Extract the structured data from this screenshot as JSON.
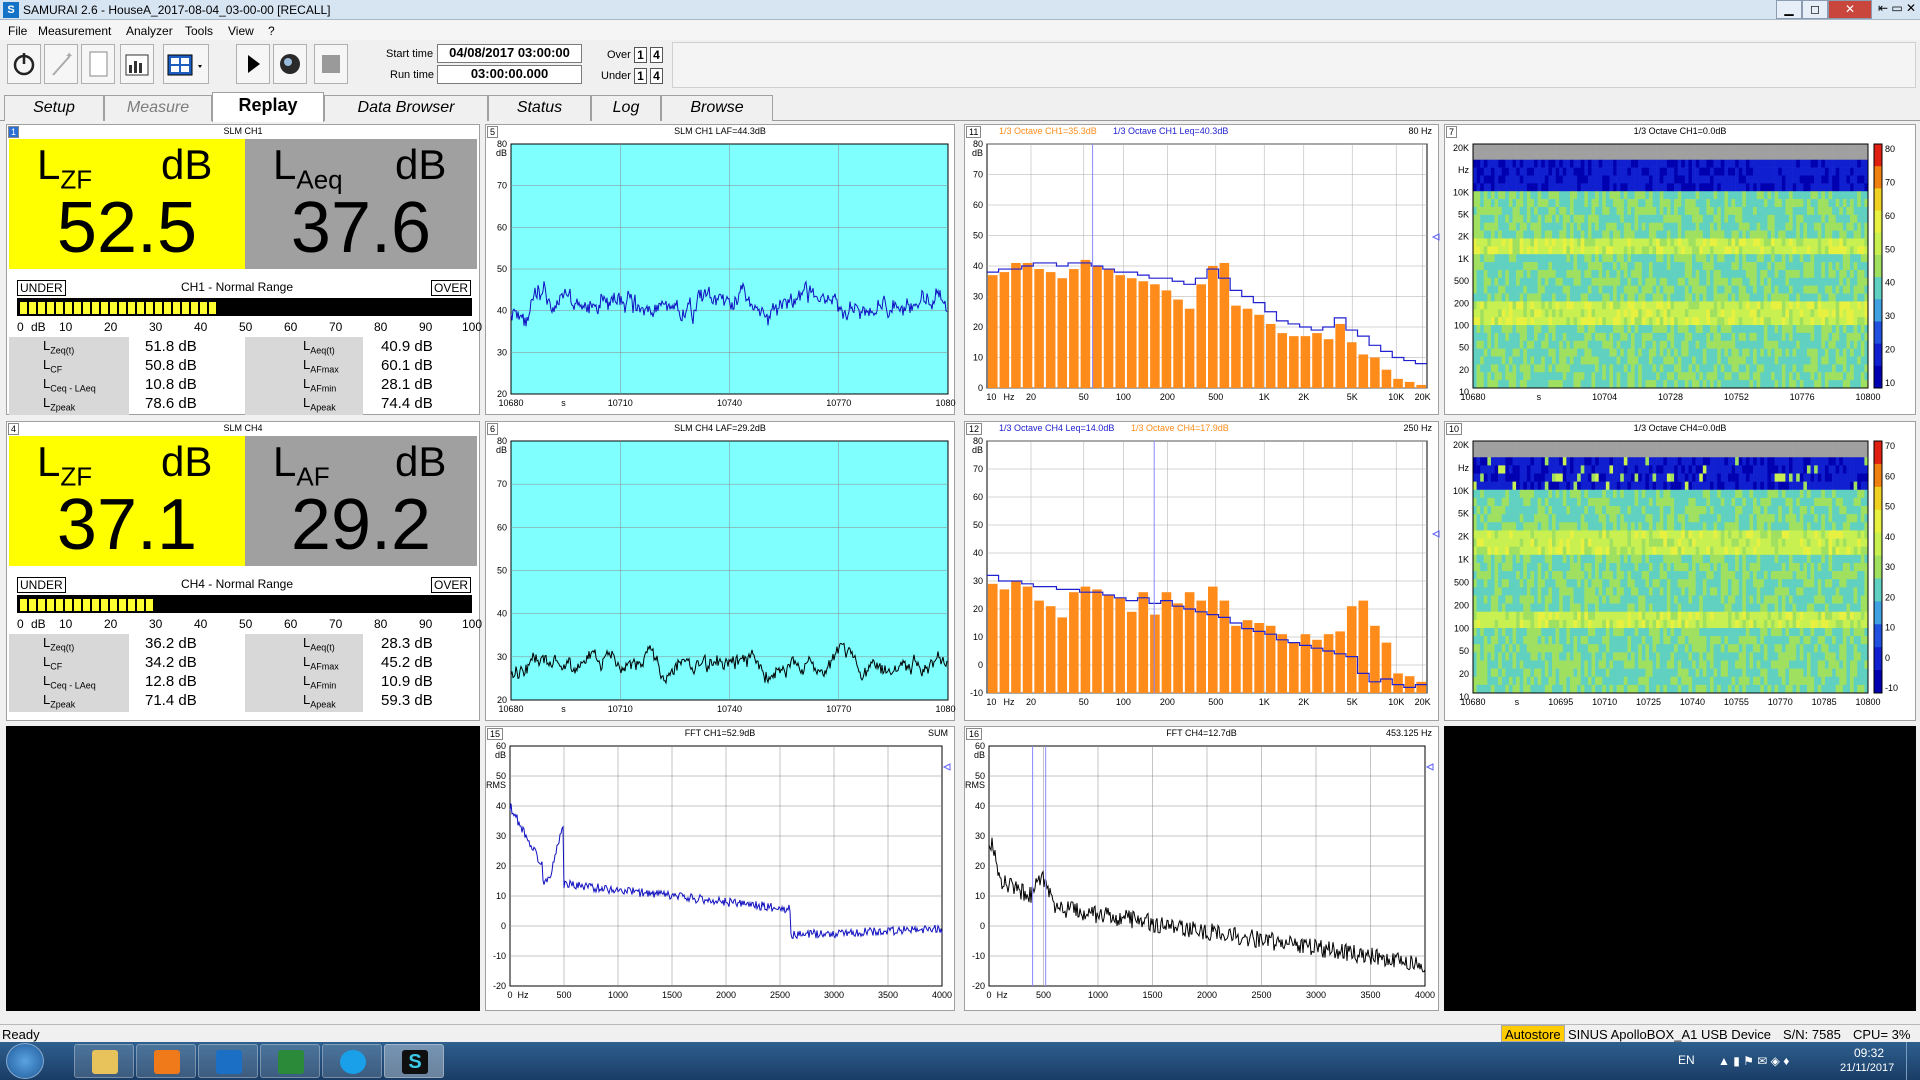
{
  "window": {
    "title": "SAMURAI 2.6 - HouseA_2017-08-04_03-00-00 [RECALL]",
    "app_icon": "S"
  },
  "menu": [
    "File",
    "Measurement",
    "Analyzer",
    "Tools",
    "View",
    "?"
  ],
  "toolbar": {
    "start_label": "Start time",
    "start_value": "04/08/2017 03:00:00",
    "run_label": "Run time",
    "run_value": "03:00:00.000",
    "over_label": "Over",
    "under_label": "Under",
    "flag1": "1",
    "flag4": "4"
  },
  "tabs": [
    "Setup",
    "Measure",
    "Replay",
    "Data Browser",
    "Status",
    "Log",
    "Browse"
  ],
  "slm": [
    {
      "num": "1",
      "title": "SLM CH1",
      "main_label": "L",
      "main_sub": "ZF",
      "main_unit": "dB",
      "main_value": "52.5",
      "sec_label": "L",
      "sec_sub": "Aeq",
      "sec_unit": "dB",
      "sec_value": "37.6",
      "range": "CH1 - Normal Range",
      "under": "UNDER",
      "over": "OVER",
      "bar_level": 0.43,
      "left_stats": [
        {
          "l": "L",
          "s": "Zeq(t)",
          "v": "51.8 dB"
        },
        {
          "l": "L",
          "s": "CF",
          "v": "50.8 dB"
        },
        {
          "l": "L",
          "s": "Ceq - L",
          "s2": "Aeq",
          "v": "10.8 dB"
        },
        {
          "l": "L",
          "s": "Zpeak",
          "v": "78.6 dB"
        }
      ],
      "right_stats": [
        {
          "l": "L",
          "s": "Aeq(t)",
          "v": "40.9 dB"
        },
        {
          "l": "L",
          "s": "AFmax",
          "v": "60.1 dB"
        },
        {
          "l": "L",
          "s": "AFmin",
          "v": "28.1 dB"
        },
        {
          "l": "L",
          "s": "Apeak",
          "v": "74.4 dB"
        }
      ]
    },
    {
      "num": "4",
      "title": "SLM CH4",
      "main_label": "L",
      "main_sub": "ZF",
      "main_unit": "dB",
      "main_value": "37.1",
      "sec_label": "L",
      "sec_sub": "AF",
      "sec_unit": "dB",
      "sec_value": "29.2",
      "range": "CH4 - Normal Range",
      "under": "UNDER",
      "over": "OVER",
      "bar_level": 0.3,
      "left_stats": [
        {
          "l": "L",
          "s": "Zeq(t)",
          "v": "36.2 dB"
        },
        {
          "l": "L",
          "s": "CF",
          "v": "34.2 dB"
        },
        {
          "l": "L",
          "s": "Ceq - L",
          "s2": "Aeq",
          "v": "12.8 dB"
        },
        {
          "l": "L",
          "s": "Zpeak",
          "v": "71.4 dB"
        }
      ],
      "right_stats": [
        {
          "l": "L",
          "s": "Aeq(t)",
          "v": "28.3 dB"
        },
        {
          "l": "L",
          "s": "AFmax",
          "v": "45.2 dB"
        },
        {
          "l": "L",
          "s": "AFmin",
          "v": "10.9 dB"
        },
        {
          "l": "L",
          "s": "Apeak",
          "v": "59.3 dB"
        }
      ]
    }
  ],
  "scale_labels": [
    "0",
    "dB",
    "10",
    "20",
    "30",
    "40",
    "50",
    "60",
    "70",
    "80",
    "90",
    "100"
  ],
  "panels": {
    "p5": {
      "num": "5",
      "title": "SLM CH1 LAF=44.3dB",
      "ylabel": "dB",
      "yticks": [
        "80",
        "70",
        "60",
        "50",
        "40",
        "30",
        "20"
      ],
      "xticks": [
        "10680",
        "s",
        "10710",
        "10740",
        "10770",
        "10800"
      ]
    },
    "p6": {
      "num": "6",
      "title": "SLM CH4 LAF=29.2dB",
      "ylabel": "dB",
      "yticks": [
        "80",
        "70",
        "60",
        "50",
        "40",
        "30",
        "20"
      ],
      "xticks": [
        "10680",
        "s",
        "10710",
        "10740",
        "10770",
        "10800"
      ]
    },
    "p11": {
      "num": "11",
      "title_a": "1/3 Octave CH1=35.3dB",
      "title_b": "1/3 Octave CH1 Leq=40.3dB",
      "right": "80 Hz",
      "ylabel": "dB",
      "yticks": [
        "80",
        "70",
        "60",
        "50",
        "40",
        "30",
        "20",
        "10",
        "0"
      ],
      "xticks": [
        "10",
        "Hz",
        "20",
        "50",
        "100",
        "200",
        "500",
        "1K",
        "2K",
        "5K",
        "10K",
        "20K"
      ]
    },
    "p12": {
      "num": "12",
      "title_a": "1/3 Octave CH4 Leq=14.0dB",
      "title_b": "1/3 Octave CH4=17.9dB",
      "right": "250 Hz",
      "ylabel": "dB",
      "yticks": [
        "80",
        "70",
        "60",
        "50",
        "40",
        "30",
        "20",
        "10",
        "0",
        "-10"
      ],
      "xticks": [
        "10",
        "Hz",
        "20",
        "50",
        "100",
        "200",
        "500",
        "1K",
        "2K",
        "5K",
        "10K",
        "20K"
      ]
    },
    "p7": {
      "num": "7",
      "title": "1/3 Octave CH1=0.0dB",
      "yticks": [
        "20K",
        "Hz",
        "10K",
        "5K",
        "2K",
        "1K",
        "500",
        "200",
        "100",
        "50",
        "20",
        "10"
      ],
      "xticks": [
        "10680",
        "s",
        "10704",
        "10728",
        "10752",
        "10776",
        "10800"
      ],
      "cticks": [
        "80",
        "70",
        "60",
        "50",
        "40",
        "30",
        "20",
        "10"
      ]
    },
    "p10": {
      "num": "10",
      "title": "1/3 Octave CH4=0.0dB",
      "yticks": [
        "20K",
        "Hz",
        "10K",
        "5K",
        "2K",
        "1K",
        "500",
        "200",
        "100",
        "50",
        "20",
        "10"
      ],
      "xticks": [
        "10680",
        "s",
        "10695",
        "10710",
        "10725",
        "10740",
        "10755",
        "10770",
        "10785",
        "10800"
      ],
      "cticks": [
        "70",
        "60",
        "50",
        "40",
        "30",
        "20",
        "10",
        "0",
        "-10"
      ]
    },
    "p15": {
      "num": "15",
      "title": "FFT CH1=52.9dB",
      "right": "SUM",
      "ylabel": "dB",
      "ylabel2": "RMS",
      "yticks": [
        "60",
        "50",
        "40",
        "30",
        "20",
        "10",
        "0",
        "-10",
        "-20"
      ],
      "xticks": [
        "0",
        "Hz",
        "500",
        "1000",
        "1500",
        "2000",
        "2500",
        "3000",
        "3500",
        "4000"
      ]
    },
    "p16": {
      "num": "16",
      "title": "FFT CH4=12.7dB",
      "right": "453.125 Hz",
      "ylabel": "dB",
      "ylabel2": "RMS",
      "yticks": [
        "60",
        "50",
        "40",
        "30",
        "20",
        "10",
        "0",
        "-10",
        "-20"
      ],
      "xticks": [
        "0",
        "Hz",
        "500",
        "1000",
        "1500",
        "2000",
        "2500",
        "3000",
        "3500",
        "4000"
      ]
    }
  },
  "status": {
    "ready": "Ready",
    "autostore": "Autostore",
    "device": "SINUS ApolloBOX_A1 USB Device",
    "sn": "S/N: 7585",
    "cpu": "CPU= 3%"
  },
  "taskbar": {
    "lang": "EN",
    "time": "09:32",
    "date": "21/11/2017"
  },
  "colors": {
    "cyan": "#80ffff",
    "orange": "#ff8c1a",
    "blue": "#2020d0",
    "yellow": "#ffff00"
  }
}
